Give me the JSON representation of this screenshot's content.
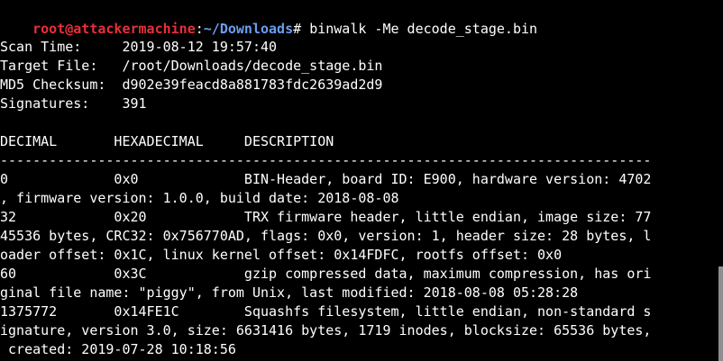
{
  "colors": {
    "background": "#000000",
    "text": "#ffffff",
    "prompt_user": "#e8303a",
    "prompt_path": "#6b9ef2",
    "scrollbar_thumb": "#8e8e8e"
  },
  "prompt": {
    "user_host": "root@attackermachine",
    "separator": ":",
    "path": "~/Downloads",
    "symbol": "# ",
    "command": "binwalk -Me decode_stage.bin"
  },
  "scan_info": [
    "Scan Time:     2019-08-12 19:57:40",
    "Target File:   /root/Downloads/decode_stage.bin",
    "MD5 Checksum:  d902e39feacd8a881783fdc2639ad2d9",
    "Signatures:    391"
  ],
  "table_header": "DECIMAL       HEXADECIMAL     DESCRIPTION",
  "separator_line": "--------------------------------------------------------------------------------",
  "output_lines": [
    "0             0x0             BIN-Header, board ID: E900, hardware version: 4702",
    ", firmware version: 1.0.0, build date: 2018-08-08",
    "32            0x20            TRX firmware header, little endian, image size: 77",
    "45536 bytes, CRC32: 0x756770AD, flags: 0x0, version: 1, header size: 28 bytes, l",
    "oader offset: 0x1C, linux kernel offset: 0x14FDFC, rootfs offset: 0x0",
    "60            0x3C            gzip compressed data, maximum compression, has ori",
    "ginal file name: \"piggy\", from Unix, last modified: 2018-08-08 05:28:28",
    "1375772       0x14FE1C        Squashfs filesystem, little endian, non-standard s",
    "ignature, version 3.0, size: 6631416 bytes, 1719 inodes, blocksize: 65536 bytes,",
    " created: 2019-07-28 10:18:56"
  ]
}
